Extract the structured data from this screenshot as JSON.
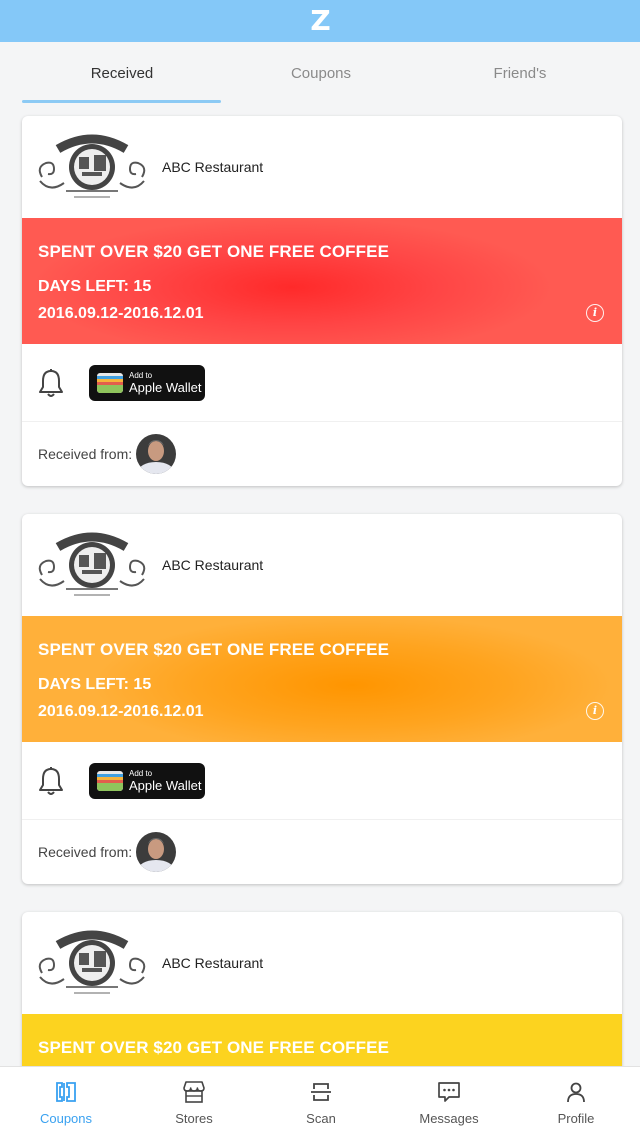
{
  "app": {
    "logo": "Z"
  },
  "tabs": [
    {
      "label": "Received",
      "active": true
    },
    {
      "label": "Coupons",
      "active": false
    },
    {
      "label": "Friend's",
      "active": false
    }
  ],
  "colors": {
    "topbar": "#84c8f8",
    "accent": "#39a1f0",
    "red": "#ff3b3b",
    "orange": "#ff9c10",
    "yellow": "#fcd31f"
  },
  "coupons": [
    {
      "store_name": "ABC Restaurant",
      "color": "red",
      "offer": "SPENT OVER $20 GET ONE FREE COFFEE",
      "days_left": "DAYS LEFT: 15",
      "date_range": "2016.09.12-2016.12.01",
      "info_icon": "i",
      "wallet_small": "Add to",
      "wallet_big": "Apple Wallet",
      "received_label": "Received from:"
    },
    {
      "store_name": "ABC Restaurant",
      "color": "orange",
      "offer": "SPENT OVER $20 GET ONE FREE COFFEE",
      "days_left": "DAYS LEFT: 15",
      "date_range": "2016.09.12-2016.12.01",
      "info_icon": "i",
      "wallet_small": "Add to",
      "wallet_big": "Apple Wallet",
      "received_label": "Received from:"
    },
    {
      "store_name": "ABC Restaurant",
      "color": "yellow",
      "offer": "SPENT OVER $20 GET ONE FREE COFFEE"
    }
  ],
  "bottom_nav": [
    {
      "label": "Coupons",
      "icon": "coupons-icon",
      "active": true
    },
    {
      "label": "Stores",
      "icon": "store-icon",
      "active": false
    },
    {
      "label": "Scan",
      "icon": "scan-icon",
      "active": false
    },
    {
      "label": "Messages",
      "icon": "messages-icon",
      "active": false
    },
    {
      "label": "Profile",
      "icon": "profile-icon",
      "active": false
    }
  ]
}
